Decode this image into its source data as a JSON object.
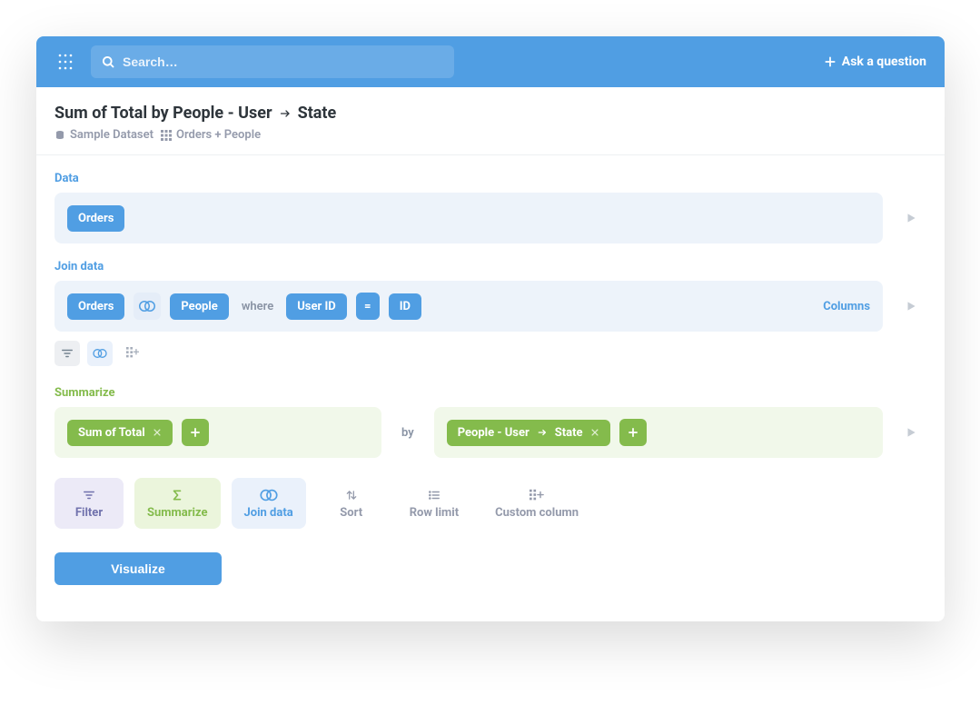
{
  "topbar": {
    "search_placeholder": "Search…",
    "ask_question": "Ask a question"
  },
  "header": {
    "title_prefix": "Sum of Total by People - User",
    "title_suffix": "State",
    "breadcrumb": {
      "db": "Sample Dataset",
      "table": "Orders + People"
    }
  },
  "data_section": {
    "label": "Data",
    "source_table": "Orders"
  },
  "join_section": {
    "label": "Join data",
    "left_table": "Orders",
    "right_table": "People",
    "where_txt": "where",
    "left_col": "User ID",
    "eq": "=",
    "right_col": "ID",
    "columns_link": "Columns"
  },
  "summarize_section": {
    "label": "Summarize",
    "aggregation": "Sum of Total",
    "by_txt": "by",
    "breakout_prefix": "People - User",
    "breakout_suffix": "State"
  },
  "actions": {
    "filter": "Filter",
    "summarize": "Summarize",
    "join_data": "Join data",
    "sort": "Sort",
    "row_limit": "Row limit",
    "custom_column": "Custom column"
  },
  "visualize_btn": "Visualize",
  "colors": {
    "blue": "#509ee3",
    "green": "#84bb4c",
    "purple": "#7172ad",
    "text": "#2e353b",
    "muted": "#949aab"
  }
}
